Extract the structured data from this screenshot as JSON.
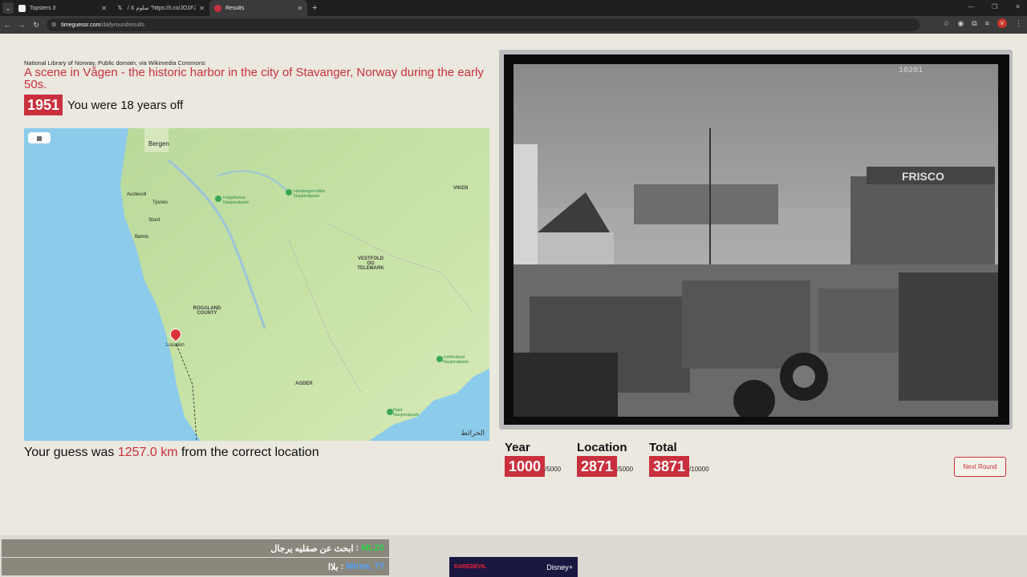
{
  "browser": {
    "tabs": [
      {
        "title": "Topsters 3",
        "active": false
      },
      {
        "title": "‎/ X سلوم \"https://t.co/JO1FJGX6DB\"",
        "active": false
      },
      {
        "title": "Results",
        "active": true
      }
    ],
    "url_host": "timeguessr.com",
    "url_path": "/dailyroundresults",
    "profile_initial": "V"
  },
  "result": {
    "attribution": "National Library of Norway, Public domain, via Wikimedia Commons",
    "caption": "A scene in Vågen - the historic harbor in the city of Stavanger, Norway during the early 50s.",
    "year": "1951",
    "year_off_text": "You were 18 years off",
    "guess_prefix": "Your guess was ",
    "guess_distance": "1257.0 km",
    "guess_suffix": " from the correct location"
  },
  "map": {
    "labels": {
      "bergen": "Bergen",
      "rogaland": "ROGALAND COUNTY",
      "vestfold": "VESTFOLD OG TELEMARK",
      "agder": "AGDER",
      "viken": "VIKEN",
      "location": "Location",
      "folgefonna": "Folgefonna Nasjonalpark",
      "hardangervidda": "Hardangervidda Nasjonalpark",
      "jomfruland": "Jomfruland Nasjonalpark",
      "raet": "Raet Nasjonalpark",
      "austevoll": "Austevoll",
      "tysnes": "Tysnes",
      "stord": "Stord",
      "bomlo": "Bømlo",
      "brand": "الخرائط"
    }
  },
  "scores": {
    "year": {
      "label": "Year",
      "value": "1000",
      "max": "/5000"
    },
    "location": {
      "label": "Location",
      "value": "2871",
      "max": "/5000"
    },
    "total": {
      "label": "Total",
      "value": "3871",
      "max": "/10000"
    }
  },
  "next_round_label": "Next Round",
  "photo": {
    "sign_text": "FRISCO",
    "corner_number": "10201"
  },
  "chat": [
    {
      "user": "MLZ0",
      "message": "ابحث عن صقليه يرجال"
    },
    {
      "user": "Mirna_77",
      "message": "بلاا"
    }
  ],
  "ad": {
    "title": "DAREDEVIL",
    "brand": "Disney+"
  }
}
